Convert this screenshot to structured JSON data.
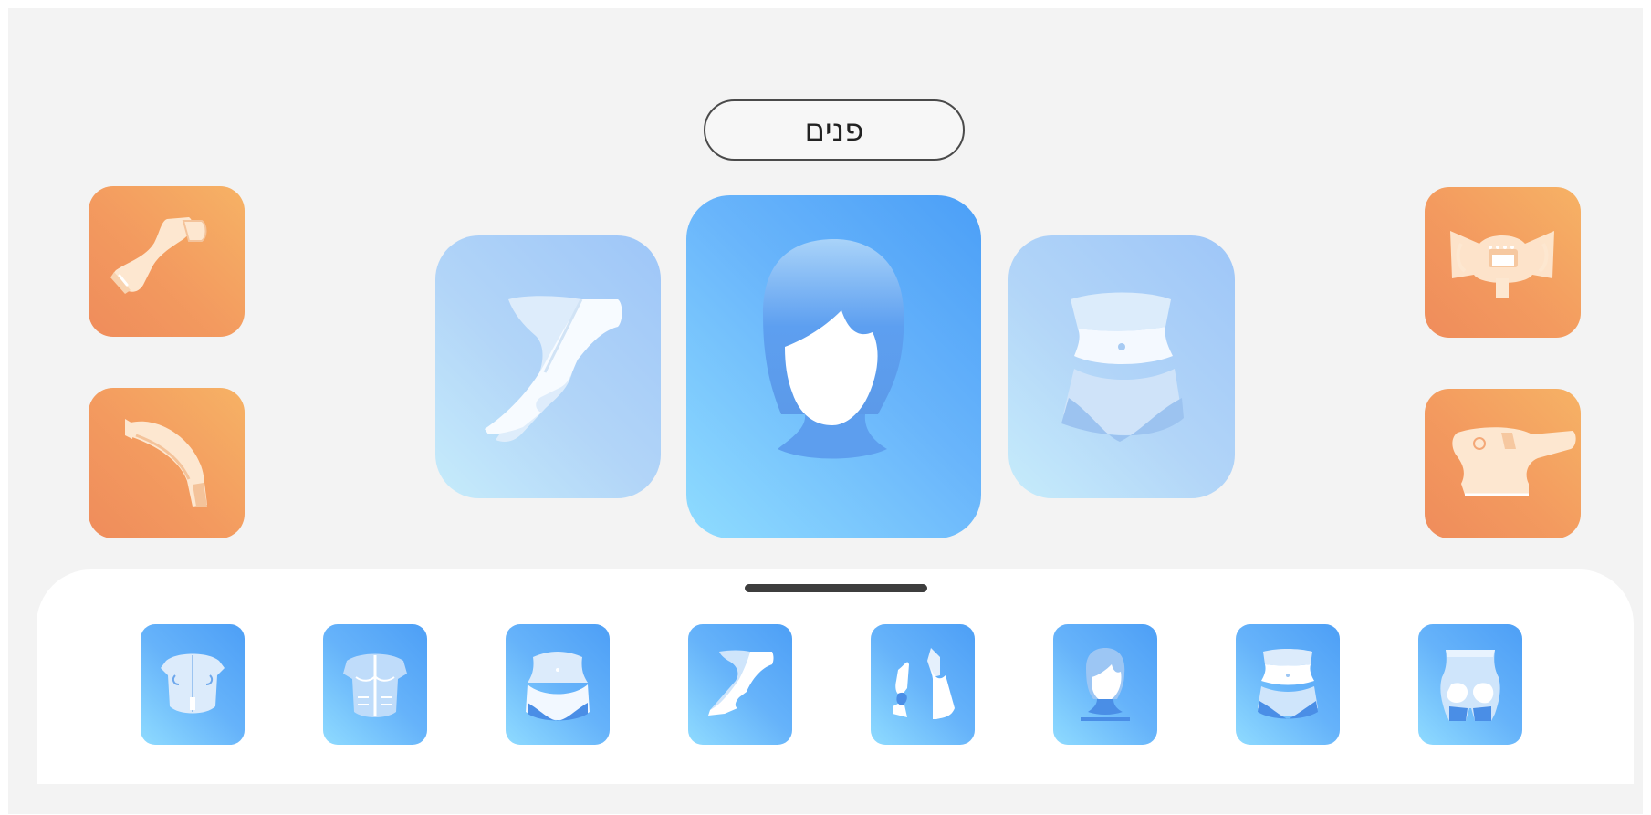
{
  "header": {
    "selected_area_label": "פנים"
  },
  "left_devices": [
    {
      "icon": "handpiece-small-icon"
    },
    {
      "icon": "handpiece-curved-icon"
    }
  ],
  "right_devices": [
    {
      "icon": "device-console-icon"
    },
    {
      "icon": "device-wand-icon"
    }
  ],
  "carousel": {
    "previous": "legs-icon",
    "current": "face-icon",
    "next": "abdomen-icon"
  },
  "body_areas": [
    {
      "icon": "back-icon"
    },
    {
      "icon": "chest-icon"
    },
    {
      "icon": "bikini-icon"
    },
    {
      "icon": "legs-icon"
    },
    {
      "icon": "arms-icon"
    },
    {
      "icon": "face-icon"
    },
    {
      "icon": "abdomen-icon"
    },
    {
      "icon": "buttocks-icon"
    }
  ],
  "colors": {
    "accent_orange": "#f39a5f",
    "accent_blue": "#4b9ff7",
    "light_blue": "#b2d5f8"
  }
}
